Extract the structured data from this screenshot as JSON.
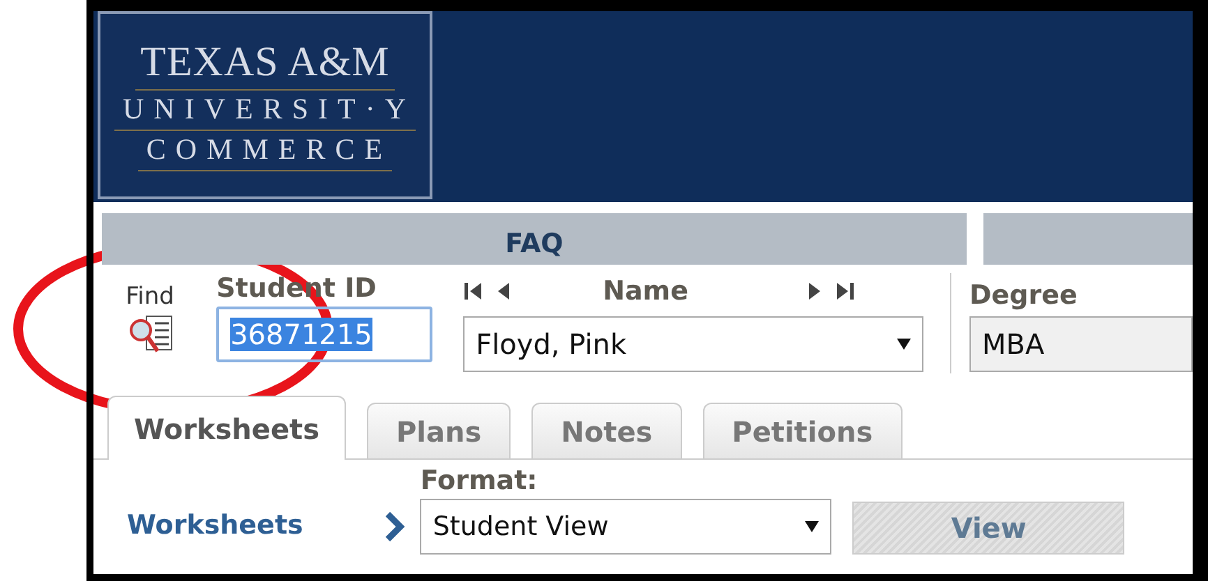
{
  "logo": {
    "lines": [
      "TEXAS A&M",
      "UNIVERSIT·Y",
      "COMMERCE"
    ]
  },
  "faq_bar": {
    "label": "FAQ"
  },
  "find": {
    "label": "Find"
  },
  "student_id": {
    "label": "Student ID",
    "value": "36871215",
    "highlighted": true
  },
  "name": {
    "label": "Name",
    "value": "Floyd, Pink"
  },
  "degree": {
    "label": "Degree",
    "value": "MBA"
  },
  "tabs": [
    {
      "label": "Worksheets",
      "selected": true
    },
    {
      "label": "Plans",
      "selected": false
    },
    {
      "label": "Notes",
      "selected": false
    },
    {
      "label": "Petitions",
      "selected": false
    }
  ],
  "worksheets": {
    "link": "Worksheets",
    "format_label": "Format:",
    "format_value": "Student View",
    "view_button": "View"
  }
}
